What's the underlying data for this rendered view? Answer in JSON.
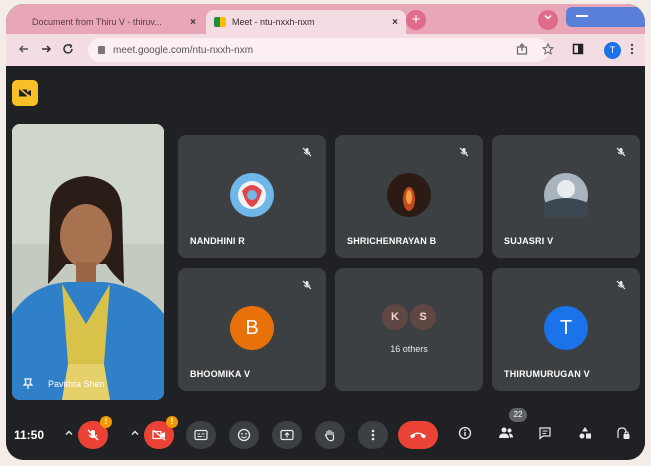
{
  "browser": {
    "tabs": [
      {
        "title": "Document from Thiru V - thiruv..."
      },
      {
        "title": "Meet - ntu-nxxh-nxm"
      }
    ],
    "tab_close_glyph": "×",
    "new_tab_glyph": "+",
    "url": "meet.google.com/ntu-nxxh-nxm",
    "profile_initial": "T"
  },
  "meet": {
    "self_tile": {
      "name": "Pavithra Shen"
    },
    "tiles": [
      {
        "name": "NANDHINI R",
        "avatar_kind": "image",
        "avatar_color": "#6fb7e6"
      },
      {
        "name": "SHRICHENRAYAN B",
        "avatar_kind": "image",
        "avatar_color": "#2b1b14"
      },
      {
        "name": "SUJASRI V",
        "avatar_kind": "image",
        "avatar_color": "#8c97a3"
      },
      {
        "name": "BHOOMIKA V",
        "avatar_kind": "initial",
        "initial": "B",
        "avatar_color": "#e8710a"
      },
      {
        "name": "16 others",
        "avatar_kind": "group",
        "initials": [
          "K",
          "S"
        ]
      },
      {
        "name": "THIRUMURUGAN V",
        "avatar_kind": "initial",
        "initial": "T",
        "avatar_color": "#1a73e8"
      }
    ],
    "bottom_bar": {
      "time": "11:50",
      "participants_count": "22"
    }
  },
  "colors": {
    "accent_red": "#ea4335",
    "warning": "#f29900",
    "camera_off_badge": "#f6c026"
  }
}
